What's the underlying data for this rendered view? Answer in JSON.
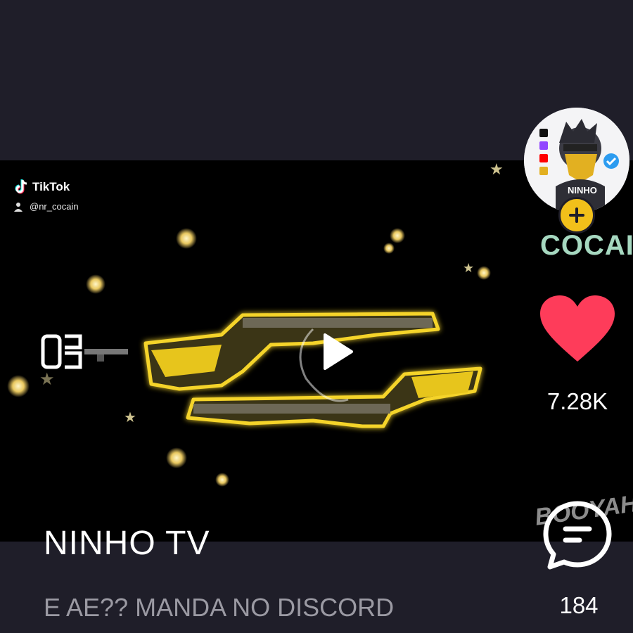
{
  "watermark": {
    "brand": "TikTok",
    "username": "@nr_cocain"
  },
  "video": {
    "play_icon": "play-icon",
    "watch_icon": "watch-icon"
  },
  "rail": {
    "avatar_icon": "avatar",
    "follow_icon": "plus-icon",
    "partial_label": "COCAI",
    "like_icon": "heart-icon",
    "like_count": "7.28K",
    "logo_text": "BOOYAH!",
    "comment_icon": "comment-icon",
    "comment_count": "184"
  },
  "post": {
    "channel_name": "NINHO TV",
    "caption": "E AE?? MANDA NO DISCORD"
  },
  "colors": {
    "background": "#1f1e29",
    "like": "#fe2c55",
    "follow": "#f2c01a",
    "weapon_gold": "#e7c51c"
  }
}
